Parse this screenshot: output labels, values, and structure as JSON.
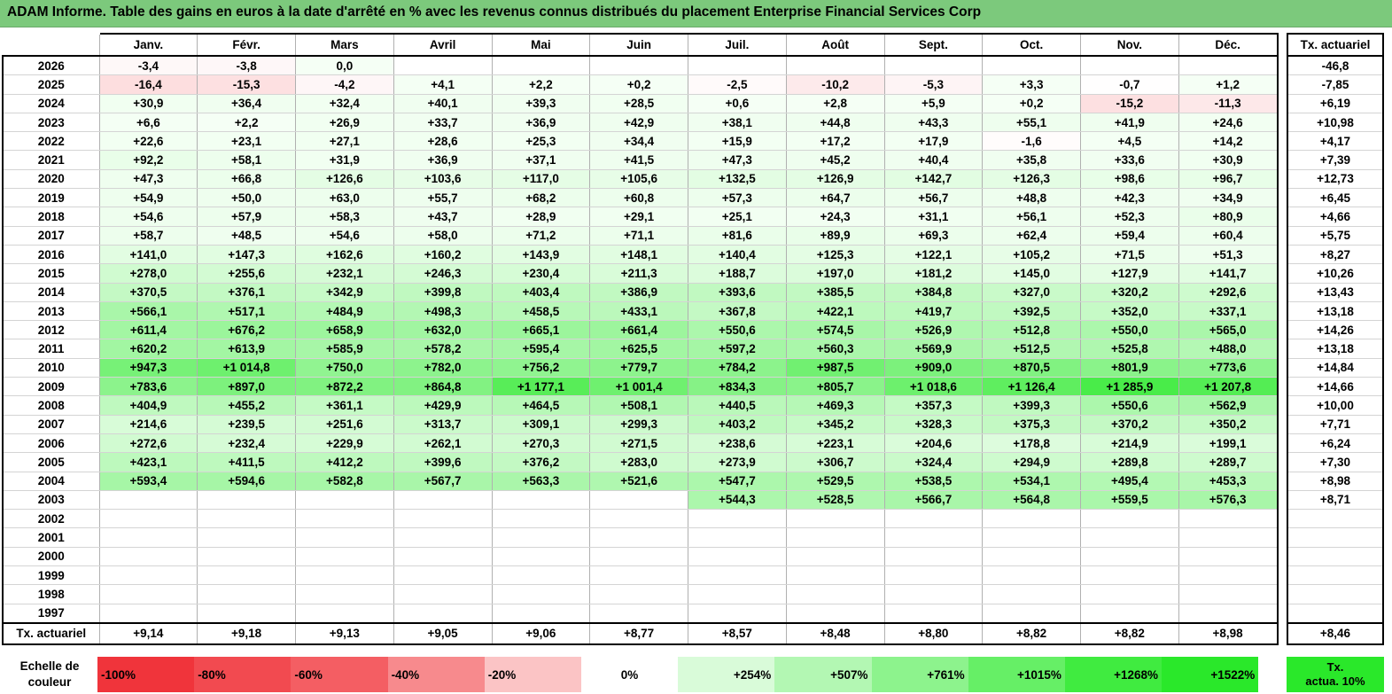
{
  "title": "ADAM Informe. Table des gains en euros à la date d'arrêté en % avec les revenus connus distribués du placement Enterprise Financial Services Corp",
  "chart_data": {
    "type": "heatmap",
    "title": "ADAM Informe. Table des gains en euros à la date d'arrêté en % avec les revenus connus distribués du placement Enterprise Financial Services Corp",
    "months": [
      "Janv.",
      "Févr.",
      "Mars",
      "Avril",
      "Mai",
      "Juin",
      "Juil.",
      "Août",
      "Sept.",
      "Oct.",
      "Nov.",
      "Déc."
    ],
    "side_header": "Tx. actuariel",
    "rows": [
      {
        "year": "2026",
        "values": [
          -3.4,
          -3.8,
          0.0,
          null,
          null,
          null,
          null,
          null,
          null,
          null,
          null,
          null
        ],
        "labels": [
          "-3,4",
          "-3,8",
          "0,0",
          "",
          "",
          "",
          "",
          "",
          "",
          "",
          "",
          ""
        ],
        "tx": "-46,8"
      },
      {
        "year": "2025",
        "values": [
          -16.4,
          -15.3,
          -4.2,
          4.1,
          2.2,
          0.2,
          -2.5,
          -10.2,
          -5.3,
          3.3,
          -0.7,
          1.2
        ],
        "labels": [
          "-16,4",
          "-15,3",
          "-4,2",
          "+4,1",
          "+2,2",
          "+0,2",
          "-2,5",
          "-10,2",
          "-5,3",
          "+3,3",
          "-0,7",
          "+1,2"
        ],
        "tx": "-7,85"
      },
      {
        "year": "2024",
        "values": [
          30.9,
          36.4,
          32.4,
          40.1,
          39.3,
          28.5,
          0.6,
          2.8,
          5.9,
          0.2,
          -15.2,
          -11.3
        ],
        "labels": [
          "+30,9",
          "+36,4",
          "+32,4",
          "+40,1",
          "+39,3",
          "+28,5",
          "+0,6",
          "+2,8",
          "+5,9",
          "+0,2",
          "-15,2",
          "-11,3"
        ],
        "tx": "+6,19"
      },
      {
        "year": "2023",
        "values": [
          6.6,
          2.2,
          26.9,
          33.7,
          36.9,
          42.9,
          38.1,
          44.8,
          43.3,
          55.1,
          41.9,
          24.6
        ],
        "labels": [
          "+6,6",
          "+2,2",
          "+26,9",
          "+33,7",
          "+36,9",
          "+42,9",
          "+38,1",
          "+44,8",
          "+43,3",
          "+55,1",
          "+41,9",
          "+24,6"
        ],
        "tx": "+10,98"
      },
      {
        "year": "2022",
        "values": [
          22.6,
          23.1,
          27.1,
          28.6,
          25.3,
          34.4,
          15.9,
          17.2,
          17.9,
          -1.6,
          4.5,
          14.2
        ],
        "labels": [
          "+22,6",
          "+23,1",
          "+27,1",
          "+28,6",
          "+25,3",
          "+34,4",
          "+15,9",
          "+17,2",
          "+17,9",
          "-1,6",
          "+4,5",
          "+14,2"
        ],
        "tx": "+4,17"
      },
      {
        "year": "2021",
        "values": [
          92.2,
          58.1,
          31.9,
          36.9,
          37.1,
          41.5,
          47.3,
          45.2,
          40.4,
          35.8,
          33.6,
          30.9
        ],
        "labels": [
          "+92,2",
          "+58,1",
          "+31,9",
          "+36,9",
          "+37,1",
          "+41,5",
          "+47,3",
          "+45,2",
          "+40,4",
          "+35,8",
          "+33,6",
          "+30,9"
        ],
        "tx": "+7,39"
      },
      {
        "year": "2020",
        "values": [
          47.3,
          66.8,
          126.6,
          103.6,
          117.0,
          105.6,
          132.5,
          126.9,
          142.7,
          126.3,
          98.6,
          96.7
        ],
        "labels": [
          "+47,3",
          "+66,8",
          "+126,6",
          "+103,6",
          "+117,0",
          "+105,6",
          "+132,5",
          "+126,9",
          "+142,7",
          "+126,3",
          "+98,6",
          "+96,7"
        ],
        "tx": "+12,73"
      },
      {
        "year": "2019",
        "values": [
          54.9,
          50.0,
          63.0,
          55.7,
          68.2,
          60.8,
          57.3,
          64.7,
          56.7,
          48.8,
          42.3,
          34.9
        ],
        "labels": [
          "+54,9",
          "+50,0",
          "+63,0",
          "+55,7",
          "+68,2",
          "+60,8",
          "+57,3",
          "+64,7",
          "+56,7",
          "+48,8",
          "+42,3",
          "+34,9"
        ],
        "tx": "+6,45"
      },
      {
        "year": "2018",
        "values": [
          54.6,
          57.9,
          58.3,
          43.7,
          28.9,
          29.1,
          25.1,
          24.3,
          31.1,
          56.1,
          52.3,
          80.9
        ],
        "labels": [
          "+54,6",
          "+57,9",
          "+58,3",
          "+43,7",
          "+28,9",
          "+29,1",
          "+25,1",
          "+24,3",
          "+31,1",
          "+56,1",
          "+52,3",
          "+80,9"
        ],
        "tx": "+4,66"
      },
      {
        "year": "2017",
        "values": [
          58.7,
          48.5,
          54.6,
          58.0,
          71.2,
          71.1,
          81.6,
          89.9,
          69.3,
          62.4,
          59.4,
          60.4
        ],
        "labels": [
          "+58,7",
          "+48,5",
          "+54,6",
          "+58,0",
          "+71,2",
          "+71,1",
          "+81,6",
          "+89,9",
          "+69,3",
          "+62,4",
          "+59,4",
          "+60,4"
        ],
        "tx": "+5,75"
      },
      {
        "year": "2016",
        "values": [
          141.0,
          147.3,
          162.6,
          160.2,
          143.9,
          148.1,
          140.4,
          125.3,
          122.1,
          105.2,
          71.5,
          51.3
        ],
        "labels": [
          "+141,0",
          "+147,3",
          "+162,6",
          "+160,2",
          "+143,9",
          "+148,1",
          "+140,4",
          "+125,3",
          "+122,1",
          "+105,2",
          "+71,5",
          "+51,3"
        ],
        "tx": "+8,27"
      },
      {
        "year": "2015",
        "values": [
          278.0,
          255.6,
          232.1,
          246.3,
          230.4,
          211.3,
          188.7,
          197.0,
          181.2,
          145.0,
          127.9,
          141.7
        ],
        "labels": [
          "+278,0",
          "+255,6",
          "+232,1",
          "+246,3",
          "+230,4",
          "+211,3",
          "+188,7",
          "+197,0",
          "+181,2",
          "+145,0",
          "+127,9",
          "+141,7"
        ],
        "tx": "+10,26"
      },
      {
        "year": "2014",
        "values": [
          370.5,
          376.1,
          342.9,
          399.8,
          403.4,
          386.9,
          393.6,
          385.5,
          384.8,
          327.0,
          320.2,
          292.6
        ],
        "labels": [
          "+370,5",
          "+376,1",
          "+342,9",
          "+399,8",
          "+403,4",
          "+386,9",
          "+393,6",
          "+385,5",
          "+384,8",
          "+327,0",
          "+320,2",
          "+292,6"
        ],
        "tx": "+13,43"
      },
      {
        "year": "2013",
        "values": [
          566.1,
          517.1,
          484.9,
          498.3,
          458.5,
          433.1,
          367.8,
          422.1,
          419.7,
          392.5,
          352.0,
          337.1
        ],
        "labels": [
          "+566,1",
          "+517,1",
          "+484,9",
          "+498,3",
          "+458,5",
          "+433,1",
          "+367,8",
          "+422,1",
          "+419,7",
          "+392,5",
          "+352,0",
          "+337,1"
        ],
        "tx": "+13,18"
      },
      {
        "year": "2012",
        "values": [
          611.4,
          676.2,
          658.9,
          632.0,
          665.1,
          661.4,
          550.6,
          574.5,
          526.9,
          512.8,
          550.0,
          565.0
        ],
        "labels": [
          "+611,4",
          "+676,2",
          "+658,9",
          "+632,0",
          "+665,1",
          "+661,4",
          "+550,6",
          "+574,5",
          "+526,9",
          "+512,8",
          "+550,0",
          "+565,0"
        ],
        "tx": "+14,26"
      },
      {
        "year": "2011",
        "values": [
          620.2,
          613.9,
          585.9,
          578.2,
          595.4,
          625.5,
          597.2,
          560.3,
          569.9,
          512.5,
          525.8,
          488.0
        ],
        "labels": [
          "+620,2",
          "+613,9",
          "+585,9",
          "+578,2",
          "+595,4",
          "+625,5",
          "+597,2",
          "+560,3",
          "+569,9",
          "+512,5",
          "+525,8",
          "+488,0"
        ],
        "tx": "+13,18"
      },
      {
        "year": "2010",
        "values": [
          947.3,
          1014.8,
          750.0,
          782.0,
          756.2,
          779.7,
          784.2,
          987.5,
          909.0,
          870.5,
          801.9,
          773.6
        ],
        "labels": [
          "+947,3",
          "+1 014,8",
          "+750,0",
          "+782,0",
          "+756,2",
          "+779,7",
          "+784,2",
          "+987,5",
          "+909,0",
          "+870,5",
          "+801,9",
          "+773,6"
        ],
        "tx": "+14,84"
      },
      {
        "year": "2009",
        "values": [
          783.6,
          897.0,
          872.2,
          864.8,
          1177.1,
          1001.4,
          834.3,
          805.7,
          1018.6,
          1126.4,
          1285.9,
          1207.8
        ],
        "labels": [
          "+783,6",
          "+897,0",
          "+872,2",
          "+864,8",
          "+1 177,1",
          "+1 001,4",
          "+834,3",
          "+805,7",
          "+1 018,6",
          "+1 126,4",
          "+1 285,9",
          "+1 207,8"
        ],
        "tx": "+14,66"
      },
      {
        "year": "2008",
        "values": [
          404.9,
          455.2,
          361.1,
          429.9,
          464.5,
          508.1,
          440.5,
          469.3,
          357.3,
          399.3,
          550.6,
          562.9
        ],
        "labels": [
          "+404,9",
          "+455,2",
          "+361,1",
          "+429,9",
          "+464,5",
          "+508,1",
          "+440,5",
          "+469,3",
          "+357,3",
          "+399,3",
          "+550,6",
          "+562,9"
        ],
        "tx": "+10,00"
      },
      {
        "year": "2007",
        "values": [
          214.6,
          239.5,
          251.6,
          313.7,
          309.1,
          299.3,
          403.2,
          345.2,
          328.3,
          375.3,
          370.2,
          350.2
        ],
        "labels": [
          "+214,6",
          "+239,5",
          "+251,6",
          "+313,7",
          "+309,1",
          "+299,3",
          "+403,2",
          "+345,2",
          "+328,3",
          "+375,3",
          "+370,2",
          "+350,2"
        ],
        "tx": "+7,71"
      },
      {
        "year": "2006",
        "values": [
          272.6,
          232.4,
          229.9,
          262.1,
          270.3,
          271.5,
          238.6,
          223.1,
          204.6,
          178.8,
          214.9,
          199.1
        ],
        "labels": [
          "+272,6",
          "+232,4",
          "+229,9",
          "+262,1",
          "+270,3",
          "+271,5",
          "+238,6",
          "+223,1",
          "+204,6",
          "+178,8",
          "+214,9",
          "+199,1"
        ],
        "tx": "+6,24"
      },
      {
        "year": "2005",
        "values": [
          423.1,
          411.5,
          412.2,
          399.6,
          376.2,
          283.0,
          273.9,
          306.7,
          324.4,
          294.9,
          289.8,
          289.7
        ],
        "labels": [
          "+423,1",
          "+411,5",
          "+412,2",
          "+399,6",
          "+376,2",
          "+283,0",
          "+273,9",
          "+306,7",
          "+324,4",
          "+294,9",
          "+289,8",
          "+289,7"
        ],
        "tx": "+7,30"
      },
      {
        "year": "2004",
        "values": [
          593.4,
          594.6,
          582.8,
          567.7,
          563.3,
          521.6,
          547.7,
          529.5,
          538.5,
          534.1,
          495.4,
          453.3
        ],
        "labels": [
          "+593,4",
          "+594,6",
          "+582,8",
          "+567,7",
          "+563,3",
          "+521,6",
          "+547,7",
          "+529,5",
          "+538,5",
          "+534,1",
          "+495,4",
          "+453,3"
        ],
        "tx": "+8,98"
      },
      {
        "year": "2003",
        "values": [
          null,
          null,
          null,
          null,
          null,
          null,
          544.3,
          528.5,
          566.7,
          564.8,
          559.5,
          576.3
        ],
        "labels": [
          "",
          "",
          "",
          "",
          "",
          "",
          "+544,3",
          "+528,5",
          "+566,7",
          "+564,8",
          "+559,5",
          "+576,3"
        ],
        "tx": "+8,71"
      },
      {
        "year": "2002",
        "values": [
          null,
          null,
          null,
          null,
          null,
          null,
          null,
          null,
          null,
          null,
          null,
          null
        ],
        "labels": [
          "",
          "",
          "",
          "",
          "",
          "",
          "",
          "",
          "",
          "",
          "",
          ""
        ],
        "tx": ""
      },
      {
        "year": "2001",
        "values": [
          null,
          null,
          null,
          null,
          null,
          null,
          null,
          null,
          null,
          null,
          null,
          null
        ],
        "labels": [
          "",
          "",
          "",
          "",
          "",
          "",
          "",
          "",
          "",
          "",
          "",
          ""
        ],
        "tx": ""
      },
      {
        "year": "2000",
        "values": [
          null,
          null,
          null,
          null,
          null,
          null,
          null,
          null,
          null,
          null,
          null,
          null
        ],
        "labels": [
          "",
          "",
          "",
          "",
          "",
          "",
          "",
          "",
          "",
          "",
          "",
          ""
        ],
        "tx": ""
      },
      {
        "year": "1999",
        "values": [
          null,
          null,
          null,
          null,
          null,
          null,
          null,
          null,
          null,
          null,
          null,
          null
        ],
        "labels": [
          "",
          "",
          "",
          "",
          "",
          "",
          "",
          "",
          "",
          "",
          "",
          ""
        ],
        "tx": ""
      },
      {
        "year": "1998",
        "values": [
          null,
          null,
          null,
          null,
          null,
          null,
          null,
          null,
          null,
          null,
          null,
          null
        ],
        "labels": [
          "",
          "",
          "",
          "",
          "",
          "",
          "",
          "",
          "",
          "",
          "",
          ""
        ],
        "tx": ""
      },
      {
        "year": "1997",
        "values": [
          null,
          null,
          null,
          null,
          null,
          null,
          null,
          null,
          null,
          null,
          null,
          null
        ],
        "labels": [
          "",
          "",
          "",
          "",
          "",
          "",
          "",
          "",
          "",
          "",
          "",
          ""
        ],
        "tx": ""
      }
    ],
    "footer": {
      "label": "Tx. actuariel",
      "values": [
        "+9,14",
        "+9,18",
        "+9,13",
        "+9,05",
        "+9,06",
        "+8,77",
        "+8,57",
        "+8,48",
        "+8,80",
        "+8,82",
        "+8,82",
        "+8,98"
      ],
      "tx": "+8,46"
    },
    "color_scale": {
      "label_line1": "Echelle de",
      "label_line2": "couleur",
      "steps": [
        {
          "label": "-100%",
          "color": "#f0343b"
        },
        {
          "label": "-80%",
          "color": "#f24a50"
        },
        {
          "label": "-60%",
          "color": "#f45e63"
        },
        {
          "label": "-40%",
          "color": "#f78a8d"
        },
        {
          "label": "-20%",
          "color": "#fbc4c5"
        },
        {
          "label": "0%",
          "color": "#ffffff"
        },
        {
          "label": "+254%",
          "color": "#d9fbd9"
        },
        {
          "label": "+507%",
          "color": "#b3f7b3"
        },
        {
          "label": "+761%",
          "color": "#8df38d"
        },
        {
          "label": "+1015%",
          "color": "#66ef66"
        },
        {
          "label": "+1268%",
          "color": "#40eb40"
        },
        {
          "label": "+1522%",
          "color": "#2ae82a"
        }
      ],
      "actua_line1": "Tx.",
      "actua_line2": "actua. 10%"
    }
  }
}
